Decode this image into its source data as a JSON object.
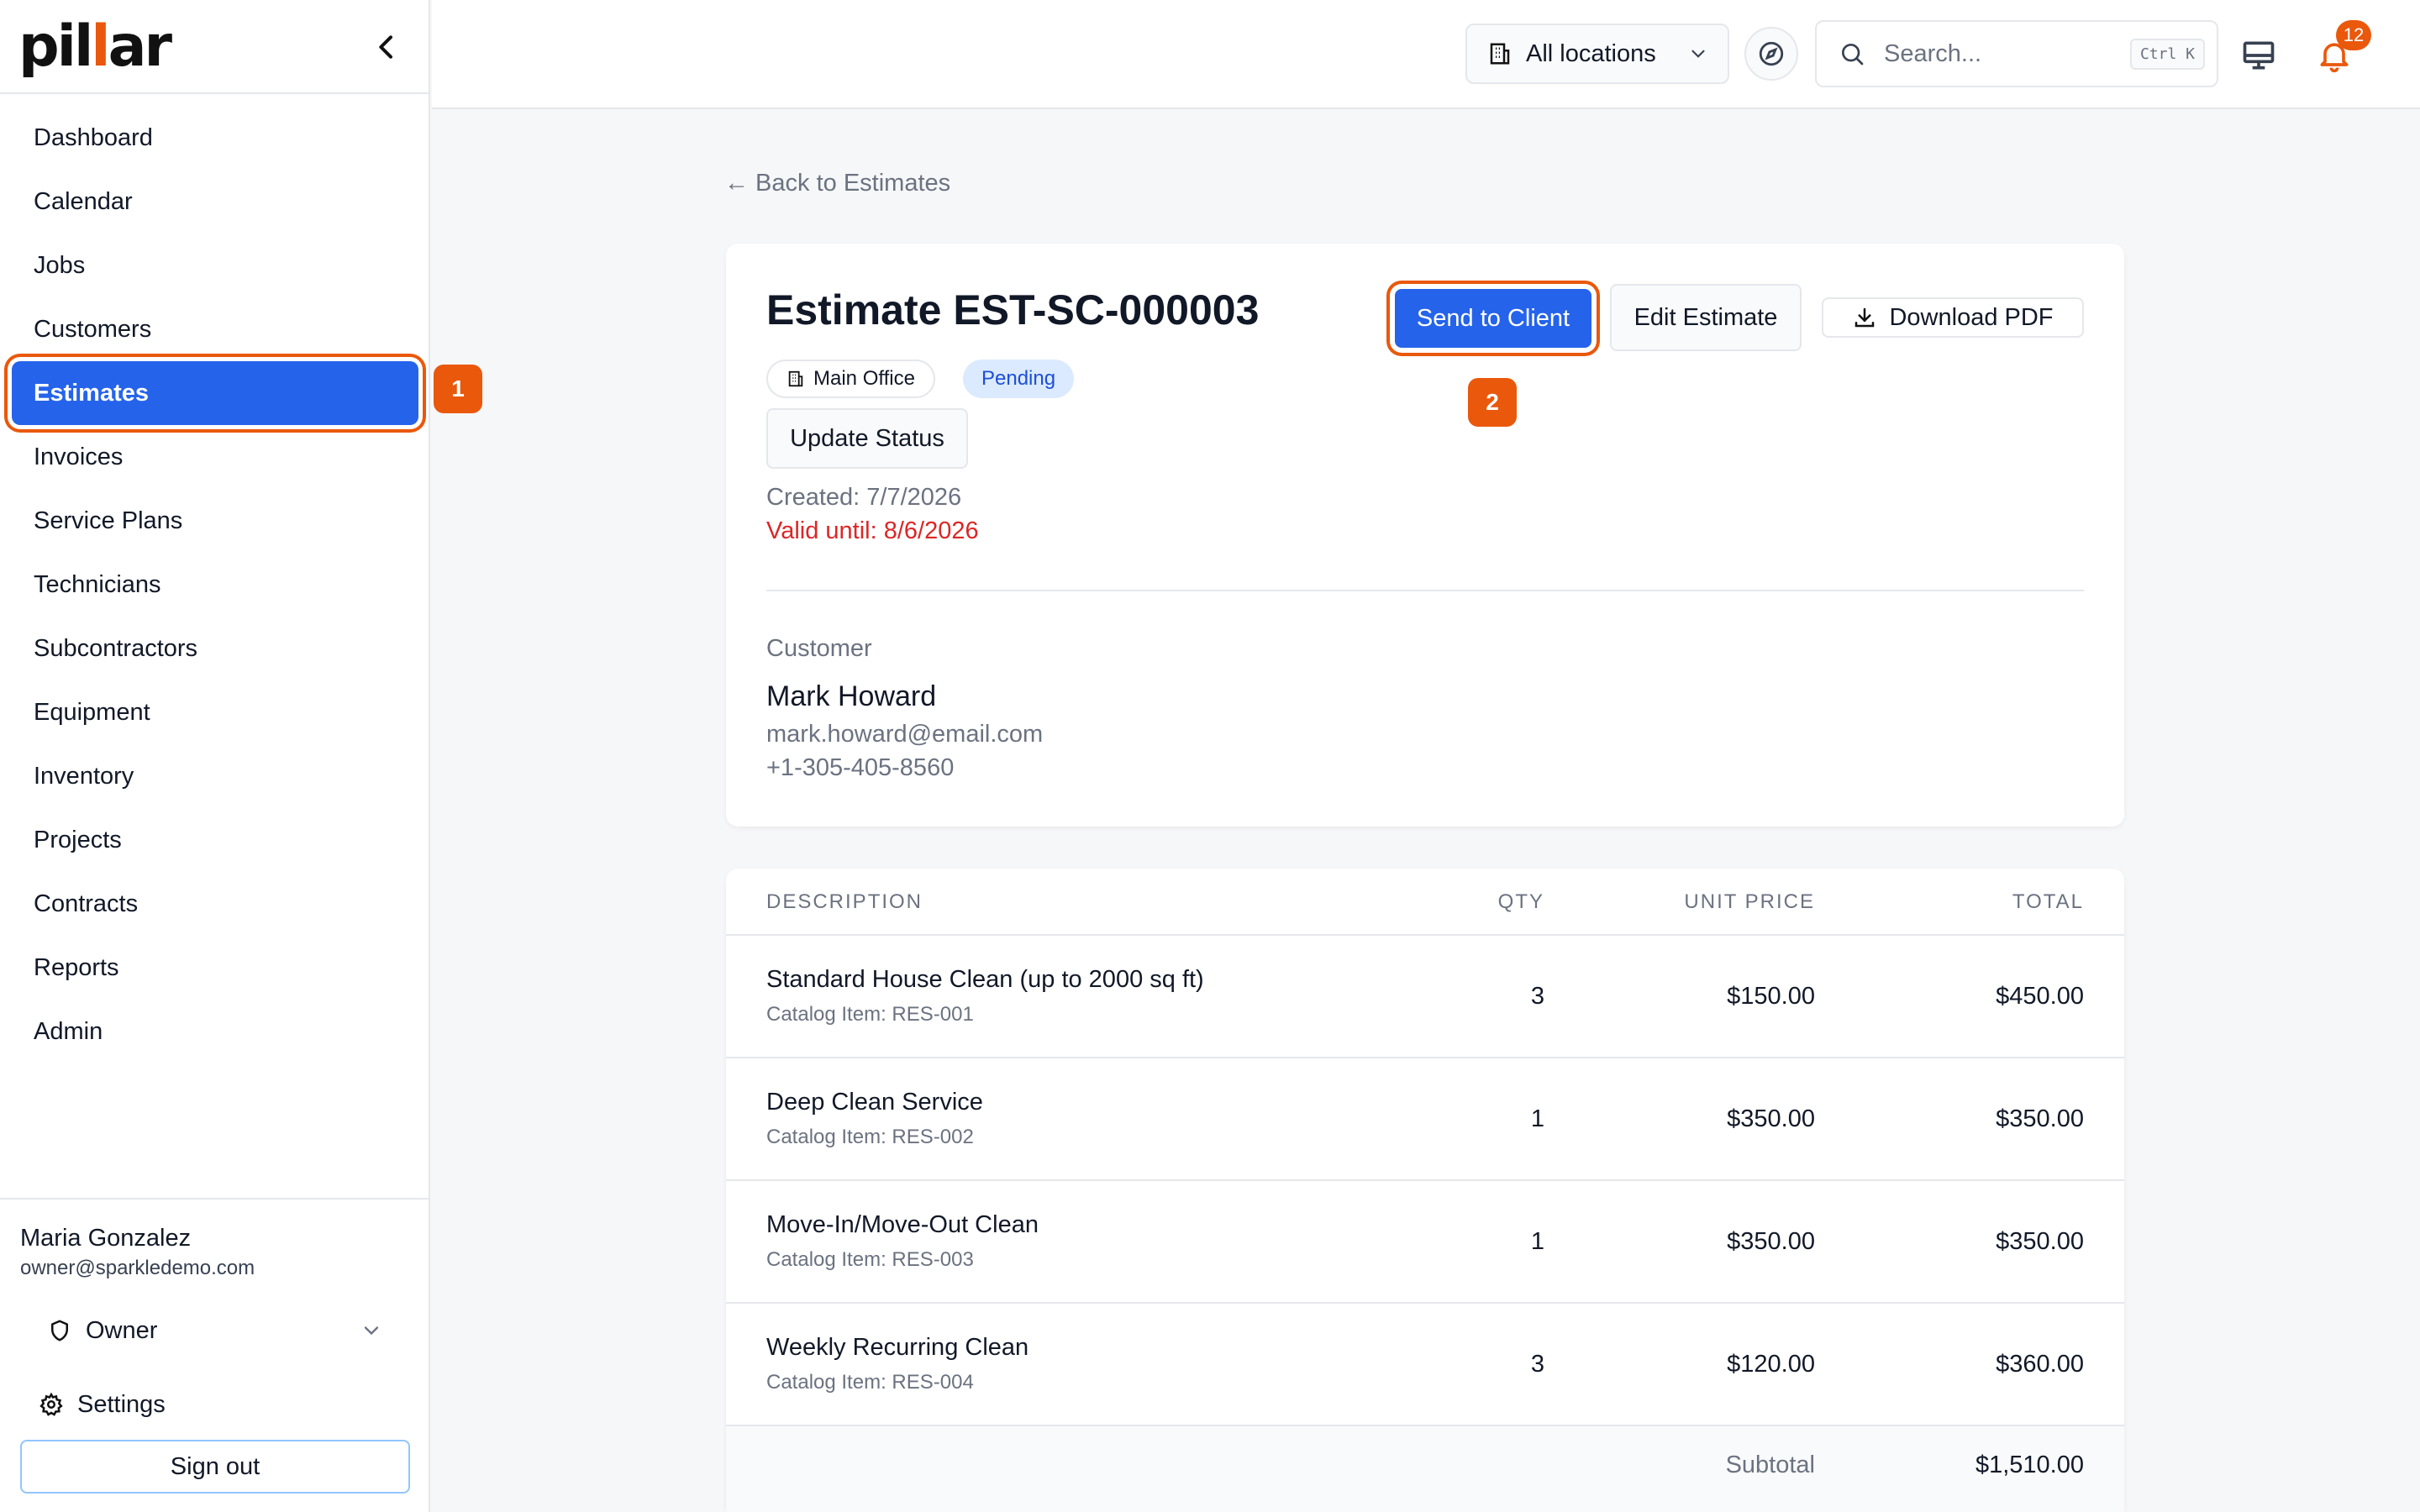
{
  "app": {
    "logo_text_a": "pil",
    "logo_text_b": "l",
    "logo_text_c": "ar"
  },
  "sidebar": {
    "items": [
      {
        "label": "Dashboard"
      },
      {
        "label": "Calendar"
      },
      {
        "label": "Jobs"
      },
      {
        "label": "Customers"
      },
      {
        "label": "Estimates",
        "active": true
      },
      {
        "label": "Invoices"
      },
      {
        "label": "Service Plans"
      },
      {
        "label": "Technicians"
      },
      {
        "label": "Subcontractors"
      },
      {
        "label": "Equipment"
      },
      {
        "label": "Inventory"
      },
      {
        "label": "Projects"
      },
      {
        "label": "Contracts"
      },
      {
        "label": "Reports"
      },
      {
        "label": "Admin"
      }
    ],
    "user": {
      "name": "Maria Gonzalez",
      "email": "owner@sparkledemo.com"
    },
    "role": "Owner",
    "settings_label": "Settings",
    "signout_label": "Sign out"
  },
  "callouts": {
    "first": "1",
    "second": "2"
  },
  "header": {
    "location_label": "All locations",
    "search_placeholder": "Search...",
    "search_shortcut": "Ctrl K",
    "notification_count": "12"
  },
  "estimate": {
    "back_label": "← Back to Estimates",
    "title": "Estimate EST-SC-000003",
    "location": "Main Office",
    "status": "Pending",
    "update_status_label": "Update Status",
    "created": "Created: 7/7/2026",
    "valid_until": "Valid until: 8/6/2026",
    "send_label": "Send to Client",
    "edit_label": "Edit Estimate",
    "pdf_label": "Download PDF",
    "customer_heading": "Customer",
    "customer": {
      "name": "Mark Howard",
      "email": "mark.howard@email.com",
      "phone": "+1-305-405-8560"
    }
  },
  "items_table": {
    "columns": {
      "description": "DESCRIPTION",
      "qty": "QTY",
      "unit_price": "UNIT PRICE",
      "total": "TOTAL"
    },
    "rows": [
      {
        "description": "Standard House Clean (up to 2000 sq ft)",
        "catalog": "Catalog Item: RES-001",
        "qty": "3",
        "unit_price": "$150.00",
        "total": "$450.00"
      },
      {
        "description": "Deep Clean Service",
        "catalog": "Catalog Item: RES-002",
        "qty": "1",
        "unit_price": "$350.00",
        "total": "$350.00"
      },
      {
        "description": "Move-In/Move-Out Clean",
        "catalog": "Catalog Item: RES-003",
        "qty": "1",
        "unit_price": "$350.00",
        "total": "$350.00"
      },
      {
        "description": "Weekly Recurring Clean",
        "catalog": "Catalog Item: RES-004",
        "qty": "3",
        "unit_price": "$120.00",
        "total": "$360.00"
      }
    ],
    "subtotal_label": "Subtotal",
    "subtotal_value": "$1,510.00"
  },
  "colors": {
    "accent": "#2563eb",
    "brand": "#ea580c",
    "danger": "#dc2626"
  }
}
